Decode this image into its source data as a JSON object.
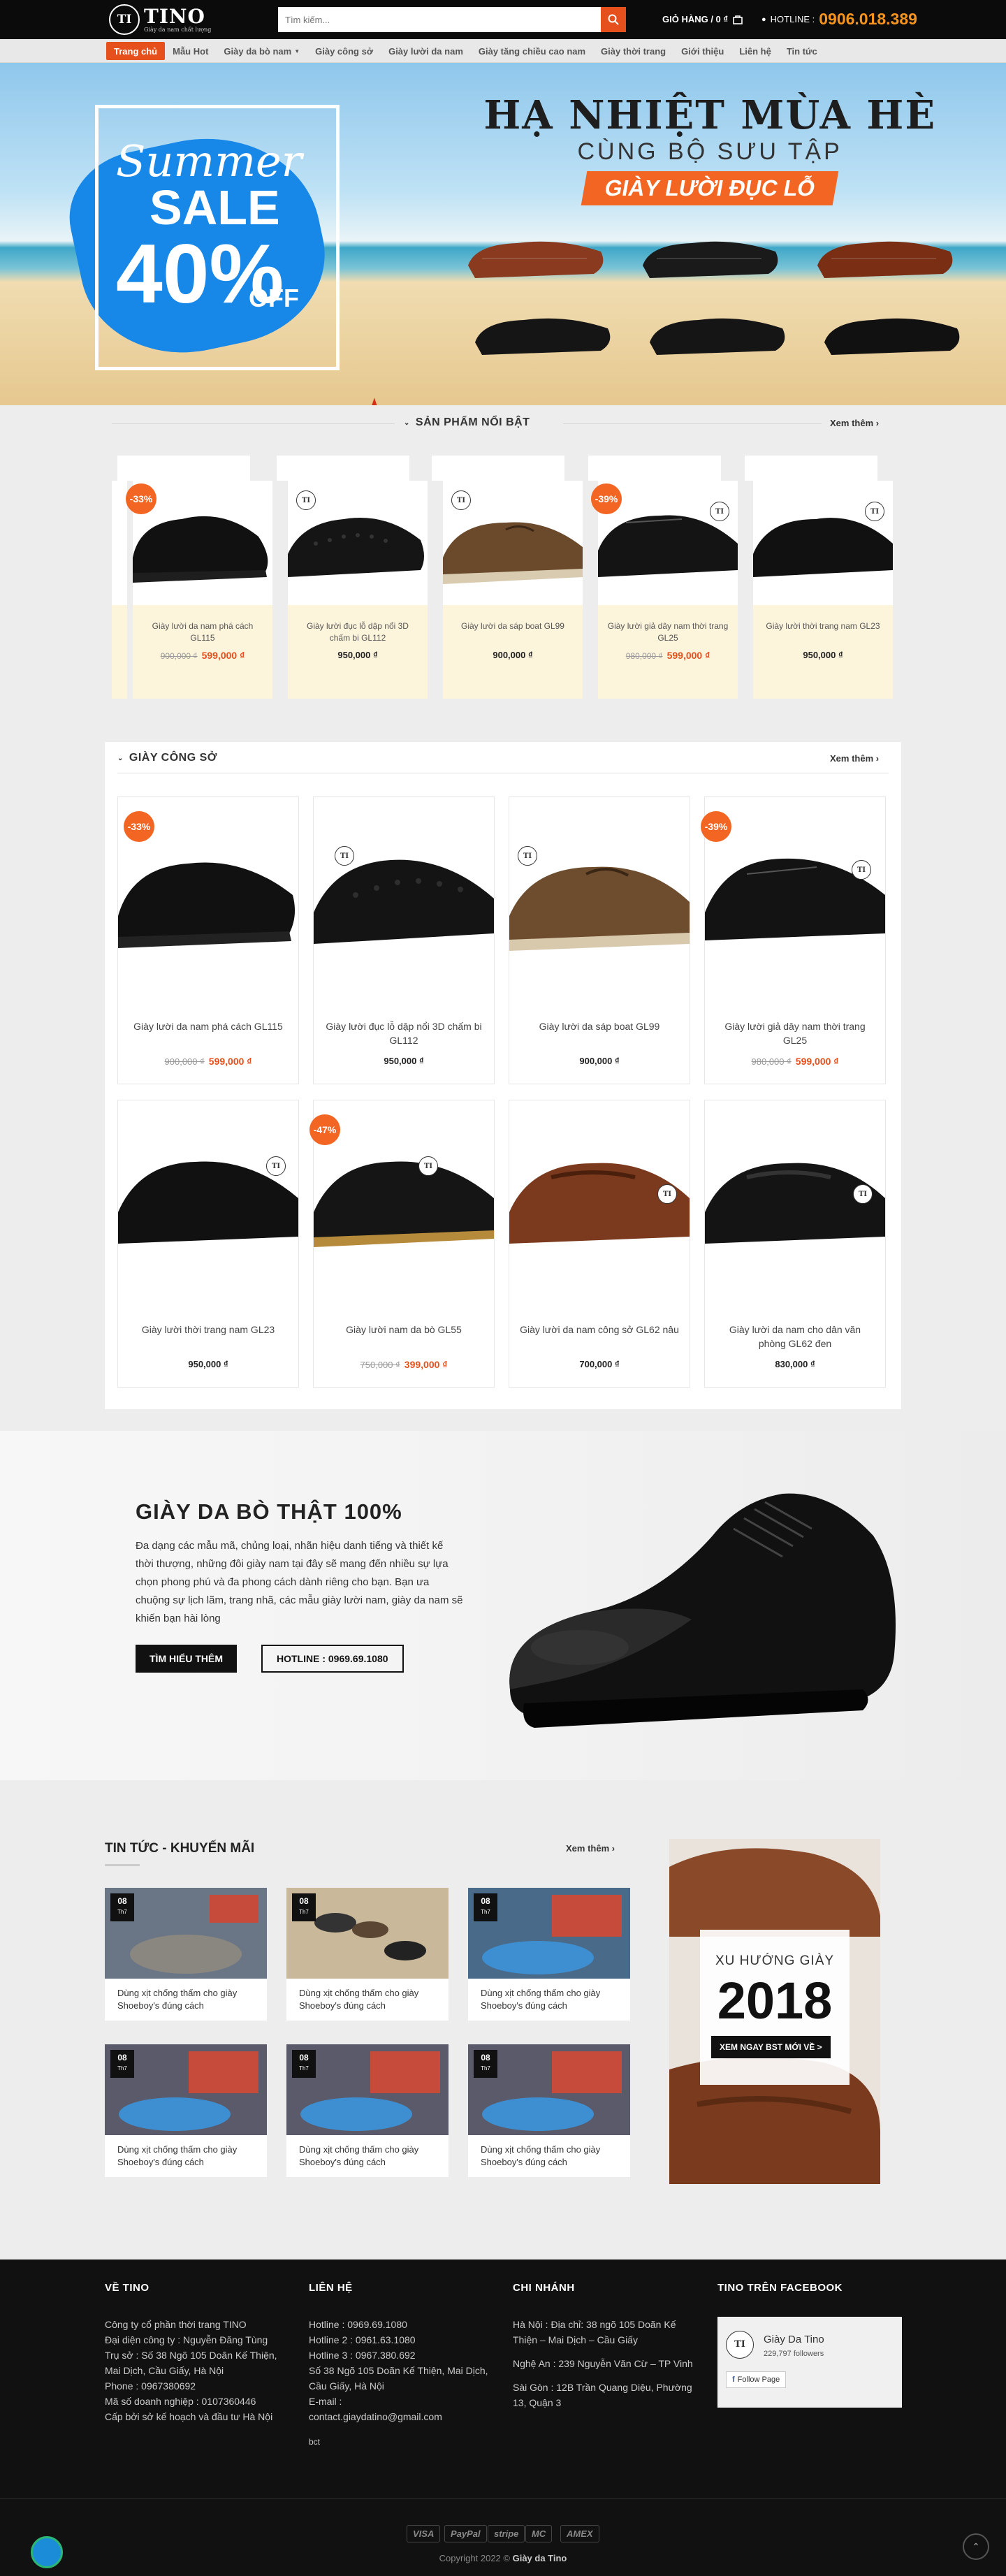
{
  "header": {
    "logo_text": "TINO",
    "logo_mark": "TI",
    "logo_tagline": "Giày da nam chất lượng",
    "search_placeholder": "Tìm kiếm...",
    "cart_label": "GIỎ HÀNG / 0 ₫",
    "hotline_label": "HOTLINE :",
    "hotline_number": "0906.018.389"
  },
  "nav": {
    "items": [
      {
        "label": "Trang chủ"
      },
      {
        "label": "Mẫu Hot"
      },
      {
        "label": "Giày da bò nam"
      },
      {
        "label": "Giày công sở"
      },
      {
        "label": "Giày lười da nam"
      },
      {
        "label": "Giày tăng chiều cao nam"
      },
      {
        "label": "Giày thời trang"
      },
      {
        "label": "Giới thiệu"
      },
      {
        "label": "Liên hệ"
      },
      {
        "label": "Tin tức"
      }
    ]
  },
  "hero": {
    "line1": "HẠ NHIỆT MÙA HÈ",
    "line2": "CÙNG BỘ SƯU TẬP",
    "line3": "GIÀY LƯỜI ĐỤC LỖ",
    "promo_summer": "Summer",
    "promo_sale": "SALE",
    "promo_pct": "40%",
    "promo_off": "OFF"
  },
  "featured": {
    "title": "SẢN PHẨM NỔI BẬT",
    "more": "Xem thêm",
    "products": [
      {
        "name": "Giày lười da nam phá cách GL115",
        "old_price": "900,000 ₫",
        "price": "599,000 ₫",
        "badge": "-33%"
      },
      {
        "name": "Giày lười đục lỗ dập nổi 3D chấm bi GL112",
        "old_price": "",
        "price": "950,000 ₫",
        "badge": ""
      },
      {
        "name": "Giày lười da sáp boat GL99",
        "old_price": "",
        "price": "900,000 ₫",
        "badge": ""
      },
      {
        "name": "Giày lười giả dây nam thời trang GL25",
        "old_price": "980,000 ₫",
        "price": "599,000 ₫",
        "badge": "-39%"
      },
      {
        "name": "Giày lười thời trang nam GL23",
        "old_price": "",
        "price": "950,000 ₫",
        "badge": ""
      }
    ]
  },
  "office": {
    "title": "GIÀY CÔNG SỞ",
    "more": "Xem thêm",
    "products": [
      {
        "name": "Giày lười da nam phá cách GL115",
        "old_price": "900,000 ₫",
        "price": "599,000 ₫",
        "badge": "-33%"
      },
      {
        "name": "Giày lười đục lỗ dập nổi 3D chấm bi GL112",
        "old_price": "",
        "price": "950,000 ₫",
        "badge": ""
      },
      {
        "name": "Giày lười da sáp boat GL99",
        "old_price": "",
        "price": "900,000 ₫",
        "badge": ""
      },
      {
        "name": "Giày lười giả dây nam thời trang GL25",
        "old_price": "980,000 ₫",
        "price": "599,000 ₫",
        "badge": "-39%"
      },
      {
        "name": "Giày lười thời trang nam GL23",
        "old_price": "",
        "price": "950,000 ₫",
        "badge": ""
      },
      {
        "name": "Giày lười nam da bò GL55",
        "old_price": "750,000 ₫",
        "price": "399,000 ₫",
        "badge": "-47%"
      },
      {
        "name": "Giày lười da nam công sở GL62 nâu",
        "old_price": "",
        "price": "700,000 ₫",
        "badge": ""
      },
      {
        "name": "Giày lười da nam cho dân văn phòng GL62 đen",
        "old_price": "",
        "price": "830,000 ₫",
        "badge": ""
      }
    ]
  },
  "leather": {
    "title": "GIÀY DA BÒ THẬT 100%",
    "description": "Đa dạng các mẫu mã, chủng loại, nhãn hiệu danh tiếng và thiết kế thời thượng, những đôi giày nam tại đây sẽ mang đến nhiều sự lựa chọn phong phú và đa phong cách dành riêng cho bạn. Bạn ưa chuộng sự lịch lãm, trang nhã, các mẫu giày lười nam, giày da nam sẽ khiến bạn hài lòng",
    "btn_learn": "TÌM HIỂU THÊM",
    "btn_hotline": "HOTLINE : 0969.69.1080"
  },
  "news": {
    "title": "TIN TỨC - KHUYẾN MÃI",
    "more": "Xem thêm",
    "items": [
      {
        "day": "08",
        "month": "Th7",
        "title": "Dùng xịt chống thấm cho giày Shoeboy's đúng cách"
      },
      {
        "day": "08",
        "month": "Th7",
        "title": "Dùng xịt chống thấm cho giày Shoeboy's đúng cách"
      },
      {
        "day": "08",
        "month": "Th7",
        "title": "Dùng xịt chống thấm cho giày Shoeboy's đúng cách"
      },
      {
        "day": "08",
        "month": "Th7",
        "title": "Dùng xịt chống thấm cho giày Shoeboy's đúng cách"
      },
      {
        "day": "08",
        "month": "Th7",
        "title": "Dùng xịt chống thấm cho giày Shoeboy's đúng cách"
      },
      {
        "day": "08",
        "month": "Th7",
        "title": "Dùng xịt chống thấm cho giày Shoeboy's đúng cách"
      }
    ]
  },
  "trend": {
    "line1": "XU HƯỚNG GIÀY",
    "year": "2018",
    "cta": "XEM NGAY BST MỚI VỀ >"
  },
  "footer": {
    "about": {
      "title": "VỀ TINO",
      "lines": [
        "Công ty cổ phần thời trang TINO",
        "Đại diện công ty : Nguyễn Đăng Tùng",
        "Trụ sở : Số 38 Ngõ 105 Doãn Kế Thiện, Mai Dịch, Cầu Giấy, Hà Nội",
        "Phone : 0967380692",
        "Mã số doanh nghiệp : 0107360446",
        "Cấp bởi sở kế hoạch và đầu tư Hà Nội"
      ]
    },
    "contact": {
      "title": "LIÊN HỆ",
      "lines": [
        "Hotline : 0969.69.1080",
        "Hotline 2 : 0961.63.1080",
        "Hotline 3 : 0967.380.692",
        "Số 38 Ngõ 105 Doãn Kế Thiện, Mai Dịch, Cầu Giấy, Hà Nội",
        "E-mail :",
        "contact.giaydatino@gmail.com"
      ],
      "bct": "bct"
    },
    "branches": {
      "title": "CHI NHÁNH",
      "lines": [
        "Hà Nội : Địa chỉ: 38 ngõ 105 Doãn Kế Thiện – Mai Dịch – Cầu Giấy",
        "Nghệ An : 239 Nguyễn Văn Cừ – TP Vinh",
        "Sài Gòn : 12B Trần Quang Diệu, Phường 13, Quận 3"
      ]
    },
    "facebook": {
      "title": "TINO TRÊN FACEBOOK",
      "page_name": "Giày Da Tino",
      "followers": "229,797 followers",
      "follow_btn": "Follow Page"
    },
    "payments": [
      "VISA",
      "PayPal",
      "stripe",
      "MC",
      "AMEX"
    ],
    "copyright_prefix": "Copyright 2022 ©",
    "copyright_brand": "Giày da Tino"
  },
  "colors": {
    "accent": "#e5501c",
    "hotline": "#f7941d",
    "header_bg": "#0b0b0b",
    "footer_bg": "#111111"
  }
}
